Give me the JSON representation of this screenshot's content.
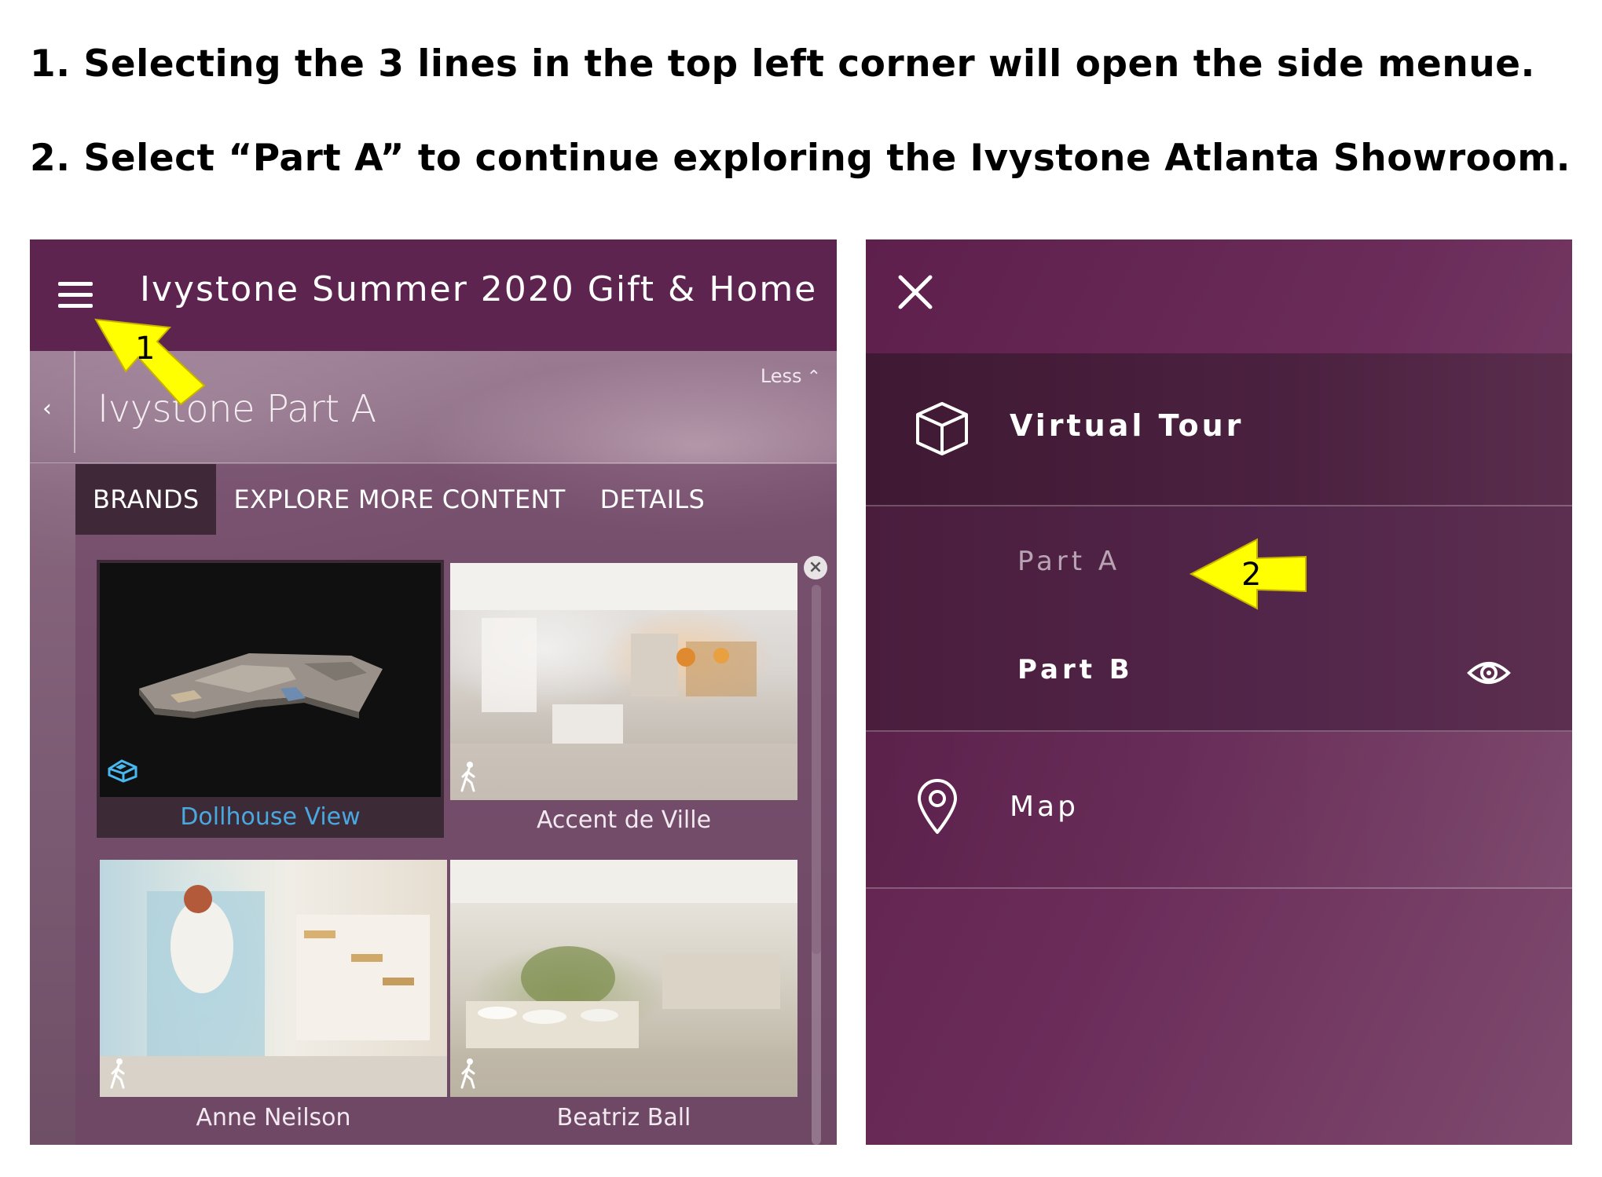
{
  "instructions": {
    "step1": "1. Selecting the 3 lines in the top left corner will open the side menue.",
    "step2": "2. Select “Part A” to continue exploring the Ivystone Atlanta Showroom."
  },
  "left_screen": {
    "app_title": "Ivystone Summer 2020 Gift & Home",
    "section_title": "Ivystone Part A",
    "less_label": "Less",
    "tabs": [
      {
        "label": "BRANDS",
        "active": true
      },
      {
        "label": "EXPLORE MORE CONTENT",
        "active": false
      },
      {
        "label": "DETAILS",
        "active": false
      }
    ],
    "cards": [
      {
        "label": "Dollhouse View",
        "icon": "dollhouse-icon"
      },
      {
        "label": "Accent de Ville",
        "icon": "walk-icon"
      },
      {
        "label": "Anne Neilson",
        "icon": "walk-icon"
      },
      {
        "label": "Beatriz Ball",
        "icon": "walk-icon"
      }
    ],
    "callout_number": "1"
  },
  "right_screen": {
    "menu": {
      "virtual_tour": {
        "label": "Virtual Tour",
        "icon": "cube-icon"
      },
      "sub_items": [
        {
          "label": "Part A"
        },
        {
          "label": "Part B",
          "icon": "eye-icon"
        }
      ],
      "map": {
        "label": "Map",
        "icon": "map-pin-icon"
      }
    },
    "callout_number": "2"
  },
  "colors": {
    "topbar": "#5d2450",
    "side_menu": "#6b2c5a",
    "callout_arrow": "#ffff00",
    "link_blue": "#4aa8e0"
  }
}
